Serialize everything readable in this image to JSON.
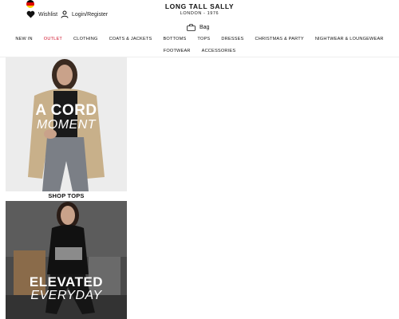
{
  "header": {
    "wishlist_label": "Wishlist",
    "login_label": "Login/Register",
    "bag_label": "Bag",
    "logo_text": "LONG TALL SALLY",
    "logo_subtext": "LONDON - 1976"
  },
  "nav": {
    "row1": [
      "NEW IN",
      "OUTLET",
      "CLOTHING",
      "COATS & JACKETS",
      "BOTTOMS",
      "TOPS",
      "DRESSES",
      "CHRISTMAS & PARTY",
      "NIGHTWEAR & LOUNGEWEAR"
    ],
    "row2": [
      "FOOTWEAR",
      "ACCESSORIES"
    ]
  },
  "promos": [
    {
      "headline_1": "A CORD",
      "headline_2": "MOMENT",
      "cta": "SHOP TOPS"
    },
    {
      "headline_1": "ELEVATED",
      "headline_2": "EVERYDAY"
    }
  ],
  "colors": {
    "accent": "#d0142c",
    "text": "#111111"
  },
  "icons": {
    "flag": "germany-flag-icon",
    "wishlist": "heart-icon",
    "login": "user-icon",
    "bag": "bag-icon"
  }
}
